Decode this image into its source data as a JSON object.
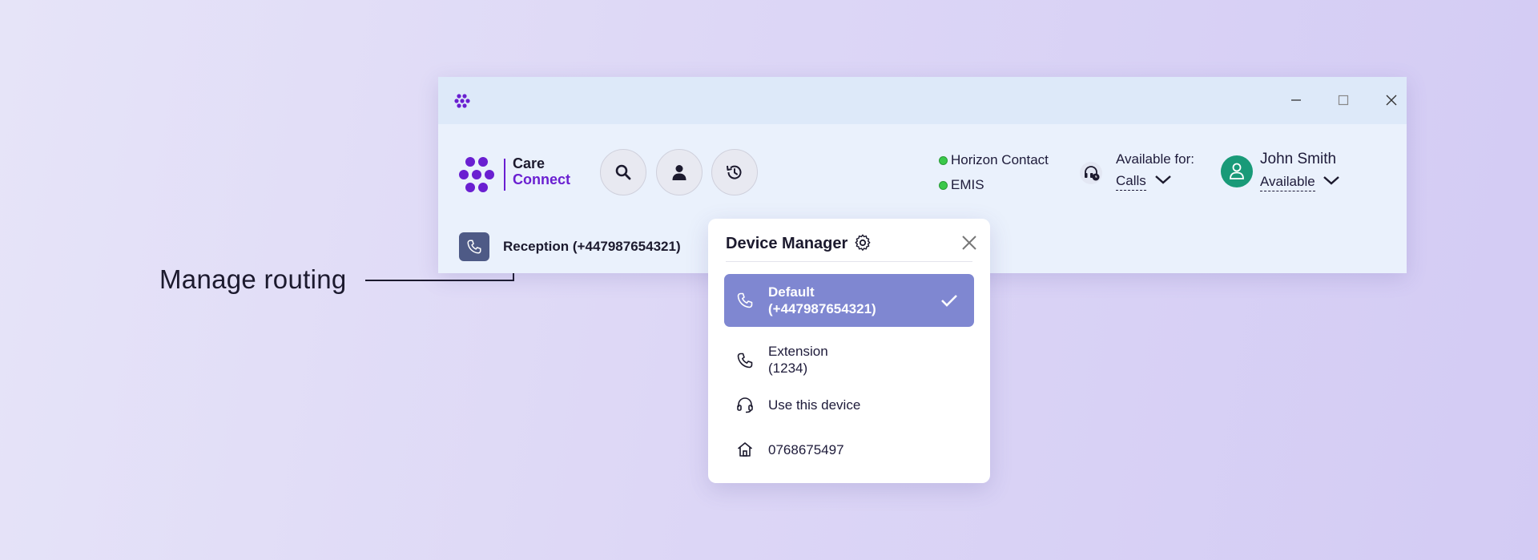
{
  "annotation": {
    "label": "Manage routing"
  },
  "brand": {
    "line1": "Care",
    "line2": "Connect"
  },
  "integrations": [
    {
      "label": "Horizon Contact",
      "status_color": "#3ac84a"
    },
    {
      "label": "EMIS",
      "status_color": "#3ac84a"
    }
  ],
  "availability": {
    "label": "Available for:",
    "value": "Calls"
  },
  "user": {
    "name": "John Smith",
    "status": "Available"
  },
  "line": {
    "label": "Reception (+447987654321)"
  },
  "device_manager": {
    "title": "Device Manager",
    "items": [
      {
        "line1": "Default",
        "line2": "(+447987654321)",
        "icon": "phone-icon",
        "selected": true
      },
      {
        "line1": "Extension",
        "line2": "(1234)",
        "icon": "phone-icon",
        "selected": false
      },
      {
        "line1": "Use this device",
        "icon": "headset-icon",
        "selected": false
      },
      {
        "line1": "0768675497",
        "icon": "home-icon",
        "selected": false
      }
    ]
  },
  "colors": {
    "brand": "#6a1fd1",
    "selected_item": "#7f87d1",
    "avatar": "#199a78",
    "line_icon": "#4e5a86"
  }
}
